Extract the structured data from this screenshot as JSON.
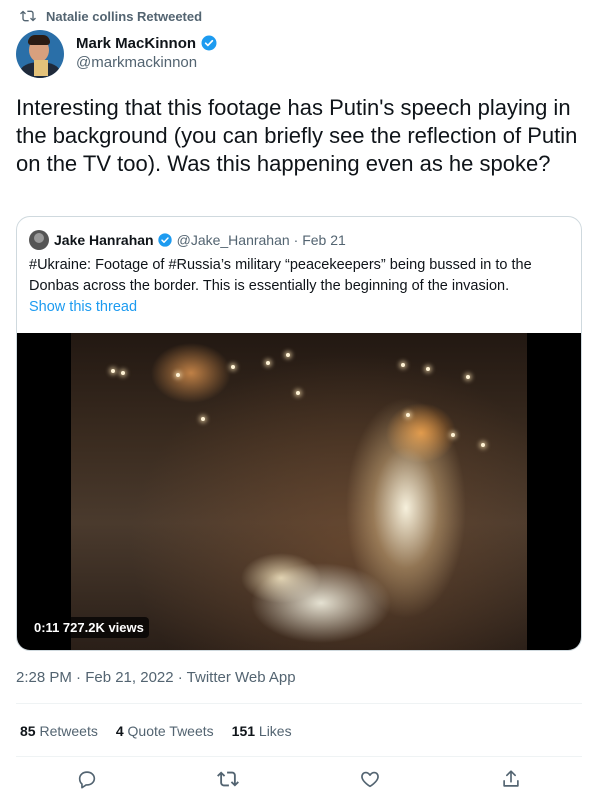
{
  "retweet_bar": {
    "text": "Natalie collins Retweeted"
  },
  "author": {
    "name": "Mark MacKinnon",
    "handle": "@markmackinnon"
  },
  "tweet": {
    "text": "Interesting that this footage has Putin's speech playing in the background (you can briefly see the reflection of Putin on the TV too). Was this happening even as he spoke?"
  },
  "quote": {
    "name": "Jake Hanrahan",
    "handle": "@Jake_Hanrahan",
    "date": "· Feb 21",
    "text": "#Ukraine: Footage of #Russia’s military “peacekeepers” being bussed in to the Donbas across the border. This is essentially the beginning of the invasion.",
    "link": "Show this thread",
    "video_badge": "0:11  727.2K views"
  },
  "meta": {
    "timestamp": "2:28 PM · Feb 21, 2022 · Twitter Web App"
  },
  "stats": {
    "retweets_count": "85",
    "retweets_label": "Retweets",
    "quotes_count": "4",
    "quotes_label": "Quote Tweets",
    "likes_count": "151",
    "likes_label": "Likes"
  },
  "icons": {
    "retweet": "retweet-icon",
    "verified": "verified-badge-icon",
    "reply": "reply-icon",
    "like": "heart-icon",
    "share": "share-icon"
  },
  "colors": {
    "accent": "#1d9bf0",
    "secondary_text": "#536471",
    "border": "#cfd9de"
  }
}
